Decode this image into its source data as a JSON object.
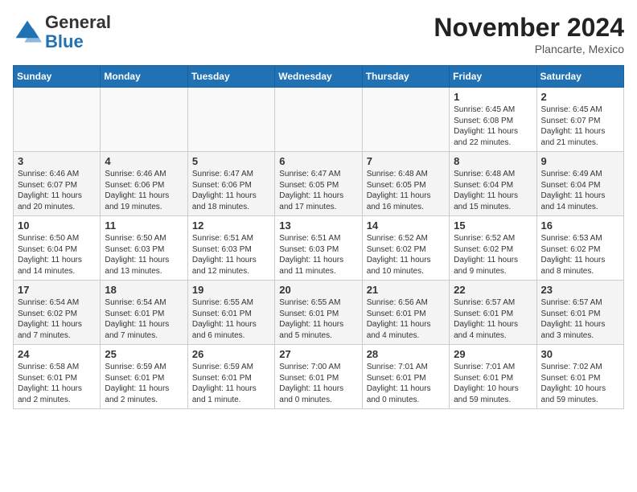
{
  "logo": {
    "general": "General",
    "blue": "Blue"
  },
  "title": "November 2024",
  "location": "Plancarte, Mexico",
  "days_header": [
    "Sunday",
    "Monday",
    "Tuesday",
    "Wednesday",
    "Thursday",
    "Friday",
    "Saturday"
  ],
  "weeks": [
    [
      {
        "day": "",
        "info": ""
      },
      {
        "day": "",
        "info": ""
      },
      {
        "day": "",
        "info": ""
      },
      {
        "day": "",
        "info": ""
      },
      {
        "day": "",
        "info": ""
      },
      {
        "day": "1",
        "info": "Sunrise: 6:45 AM\nSunset: 6:08 PM\nDaylight: 11 hours and 22 minutes."
      },
      {
        "day": "2",
        "info": "Sunrise: 6:45 AM\nSunset: 6:07 PM\nDaylight: 11 hours and 21 minutes."
      }
    ],
    [
      {
        "day": "3",
        "info": "Sunrise: 6:46 AM\nSunset: 6:07 PM\nDaylight: 11 hours and 20 minutes."
      },
      {
        "day": "4",
        "info": "Sunrise: 6:46 AM\nSunset: 6:06 PM\nDaylight: 11 hours and 19 minutes."
      },
      {
        "day": "5",
        "info": "Sunrise: 6:47 AM\nSunset: 6:06 PM\nDaylight: 11 hours and 18 minutes."
      },
      {
        "day": "6",
        "info": "Sunrise: 6:47 AM\nSunset: 6:05 PM\nDaylight: 11 hours and 17 minutes."
      },
      {
        "day": "7",
        "info": "Sunrise: 6:48 AM\nSunset: 6:05 PM\nDaylight: 11 hours and 16 minutes."
      },
      {
        "day": "8",
        "info": "Sunrise: 6:48 AM\nSunset: 6:04 PM\nDaylight: 11 hours and 15 minutes."
      },
      {
        "day": "9",
        "info": "Sunrise: 6:49 AM\nSunset: 6:04 PM\nDaylight: 11 hours and 14 minutes."
      }
    ],
    [
      {
        "day": "10",
        "info": "Sunrise: 6:50 AM\nSunset: 6:04 PM\nDaylight: 11 hours and 14 minutes."
      },
      {
        "day": "11",
        "info": "Sunrise: 6:50 AM\nSunset: 6:03 PM\nDaylight: 11 hours and 13 minutes."
      },
      {
        "day": "12",
        "info": "Sunrise: 6:51 AM\nSunset: 6:03 PM\nDaylight: 11 hours and 12 minutes."
      },
      {
        "day": "13",
        "info": "Sunrise: 6:51 AM\nSunset: 6:03 PM\nDaylight: 11 hours and 11 minutes."
      },
      {
        "day": "14",
        "info": "Sunrise: 6:52 AM\nSunset: 6:02 PM\nDaylight: 11 hours and 10 minutes."
      },
      {
        "day": "15",
        "info": "Sunrise: 6:52 AM\nSunset: 6:02 PM\nDaylight: 11 hours and 9 minutes."
      },
      {
        "day": "16",
        "info": "Sunrise: 6:53 AM\nSunset: 6:02 PM\nDaylight: 11 hours and 8 minutes."
      }
    ],
    [
      {
        "day": "17",
        "info": "Sunrise: 6:54 AM\nSunset: 6:02 PM\nDaylight: 11 hours and 7 minutes."
      },
      {
        "day": "18",
        "info": "Sunrise: 6:54 AM\nSunset: 6:01 PM\nDaylight: 11 hours and 7 minutes."
      },
      {
        "day": "19",
        "info": "Sunrise: 6:55 AM\nSunset: 6:01 PM\nDaylight: 11 hours and 6 minutes."
      },
      {
        "day": "20",
        "info": "Sunrise: 6:55 AM\nSunset: 6:01 PM\nDaylight: 11 hours and 5 minutes."
      },
      {
        "day": "21",
        "info": "Sunrise: 6:56 AM\nSunset: 6:01 PM\nDaylight: 11 hours and 4 minutes."
      },
      {
        "day": "22",
        "info": "Sunrise: 6:57 AM\nSunset: 6:01 PM\nDaylight: 11 hours and 4 minutes."
      },
      {
        "day": "23",
        "info": "Sunrise: 6:57 AM\nSunset: 6:01 PM\nDaylight: 11 hours and 3 minutes."
      }
    ],
    [
      {
        "day": "24",
        "info": "Sunrise: 6:58 AM\nSunset: 6:01 PM\nDaylight: 11 hours and 2 minutes."
      },
      {
        "day": "25",
        "info": "Sunrise: 6:59 AM\nSunset: 6:01 PM\nDaylight: 11 hours and 2 minutes."
      },
      {
        "day": "26",
        "info": "Sunrise: 6:59 AM\nSunset: 6:01 PM\nDaylight: 11 hours and 1 minute."
      },
      {
        "day": "27",
        "info": "Sunrise: 7:00 AM\nSunset: 6:01 PM\nDaylight: 11 hours and 0 minutes."
      },
      {
        "day": "28",
        "info": "Sunrise: 7:01 AM\nSunset: 6:01 PM\nDaylight: 11 hours and 0 minutes."
      },
      {
        "day": "29",
        "info": "Sunrise: 7:01 AM\nSunset: 6:01 PM\nDaylight: 10 hours and 59 minutes."
      },
      {
        "day": "30",
        "info": "Sunrise: 7:02 AM\nSunset: 6:01 PM\nDaylight: 10 hours and 59 minutes."
      }
    ]
  ]
}
